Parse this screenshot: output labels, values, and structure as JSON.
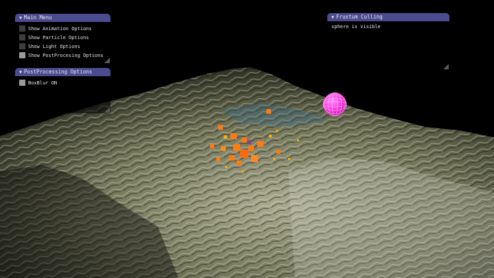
{
  "main_menu": {
    "title": "Main Menu",
    "options": [
      {
        "label": "Show Animation Options",
        "checked": false
      },
      {
        "label": "Show Particle Options",
        "checked": false
      },
      {
        "label": "Show Light Options",
        "checked": false
      },
      {
        "label": "Show PostProcesing Options",
        "checked": true
      }
    ]
  },
  "postprocessing": {
    "title": "PostProcessing Options",
    "options": [
      {
        "label": "BoxBlur ON",
        "checked": true
      }
    ]
  },
  "frustum": {
    "title": "Frustum Culling",
    "status": "sphere is visible"
  },
  "scene": {
    "terrain_light": "#d7d7c0",
    "terrain_shadow": "#1a1c14",
    "sphere_color": "#ff2fe0",
    "particle_color": "#ff7a10",
    "particle_core": "#ffb000",
    "sky": "#000000"
  }
}
